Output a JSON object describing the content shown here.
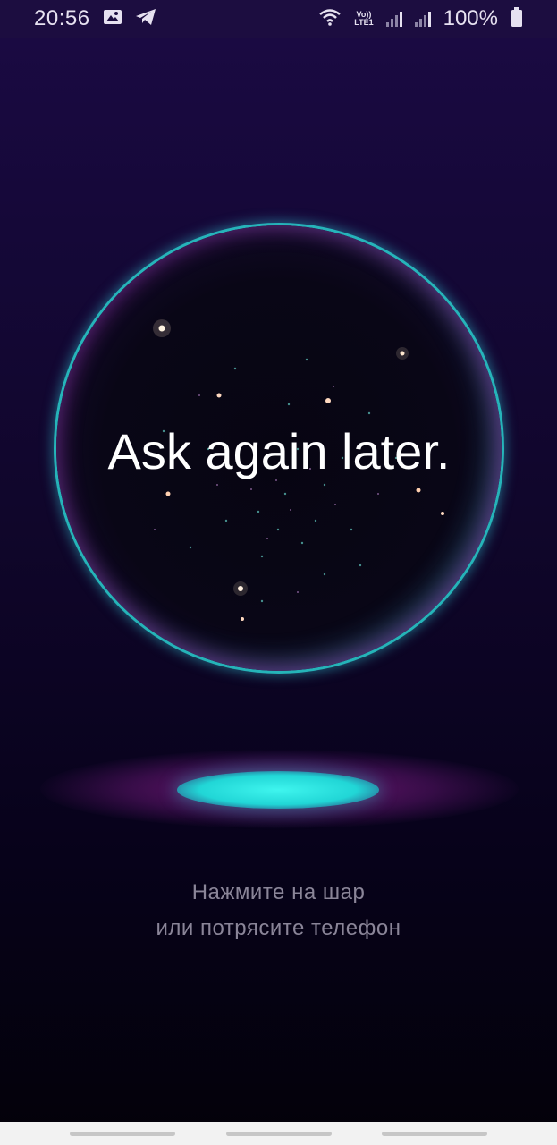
{
  "status_bar": {
    "time": "20:56",
    "notification_icons": [
      "image-icon",
      "telegram-icon"
    ],
    "network_label_top": "Vo))",
    "network_label_bottom": "LTE1",
    "battery_text": "100%"
  },
  "ball": {
    "answer": "Ask again later."
  },
  "hint": {
    "line1": "Нажмите на шар",
    "line2": "или потрясите телефон"
  },
  "colors": {
    "background_top": "#1b0a44",
    "background_bottom": "#030109",
    "ball_rim_cyan": "#28c8c8",
    "ball_rim_magenta": "#dc3ce6",
    "glow_cyan": "#3ff5ee",
    "hint_text": "#8a8598"
  }
}
